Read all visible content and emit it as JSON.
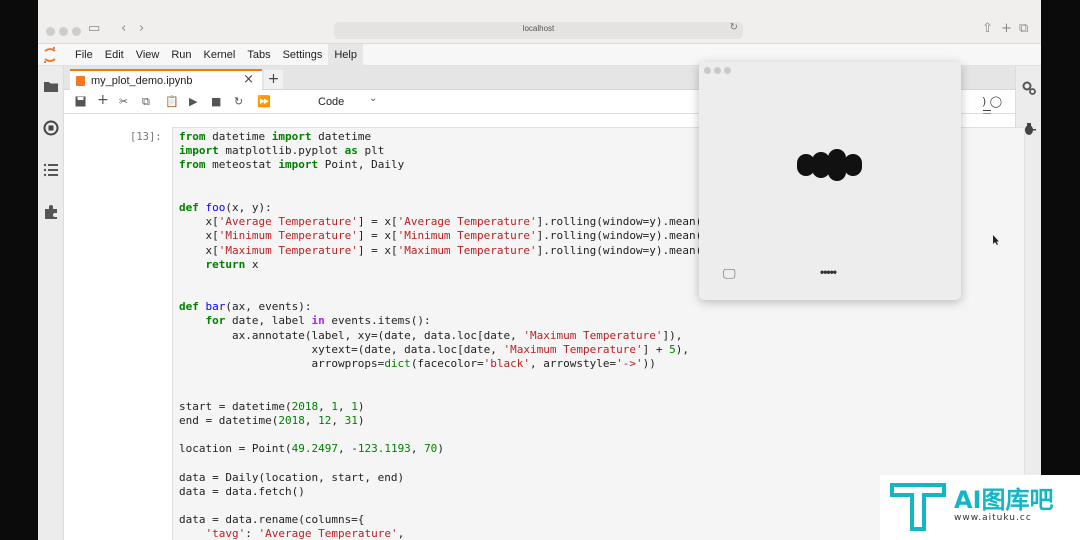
{
  "browser": {
    "url": "localhost"
  },
  "menubar": {
    "items": [
      "File",
      "Edit",
      "View",
      "Run",
      "Kernel",
      "Tabs",
      "Settings",
      "Help"
    ],
    "active": "Help"
  },
  "tab": {
    "title": "my_plot_demo.ipynb"
  },
  "toolbar": {
    "cell_type": "Code",
    "kernel_indicator": ")"
  },
  "cell": {
    "prompt": "[13]:",
    "lines": [
      "from datetime import datetime",
      "import matplotlib.pyplot as plt",
      "from meteostat import Point, Daily",
      "",
      "",
      "def foo(x, y):",
      "    x['Average Temperature'] = x['Average Temperature'].rolling(window=y).mean()",
      "    x['Minimum Temperature'] = x['Minimum Temperature'].rolling(window=y).mean()",
      "    x['Maximum Temperature'] = x['Maximum Temperature'].rolling(window=y).mean()",
      "    return x",
      "",
      "",
      "def bar(ax, events):",
      "    for date, label in events.items():",
      "        ax.annotate(label, xy=(date, data.loc[date, 'Maximum Temperature']),",
      "                    xytext=(date, data.loc[date, 'Maximum Temperature'] + 5),",
      "                    arrowprops=dict(facecolor='black', arrowstyle='->'))",
      "",
      "",
      "start = datetime(2018, 1, 1)",
      "end = datetime(2018, 12, 31)",
      "",
      "location = Point(49.2497, -123.1193, 70)",
      "",
      "data = Daily(location, start, end)",
      "data = data.fetch()",
      "",
      "data = data.rename(columns={",
      "    'tavg': 'Average Temperature',"
    ]
  },
  "overlay": {
    "footer_dots": "•••••"
  },
  "watermark": {
    "title": "AI图库吧",
    "url": "www.aituku.cc"
  },
  "colors": {
    "jupyter_orange": "#f37726",
    "keyword": "#008000",
    "string": "#ba2121",
    "watermark": "#12b6c4"
  }
}
